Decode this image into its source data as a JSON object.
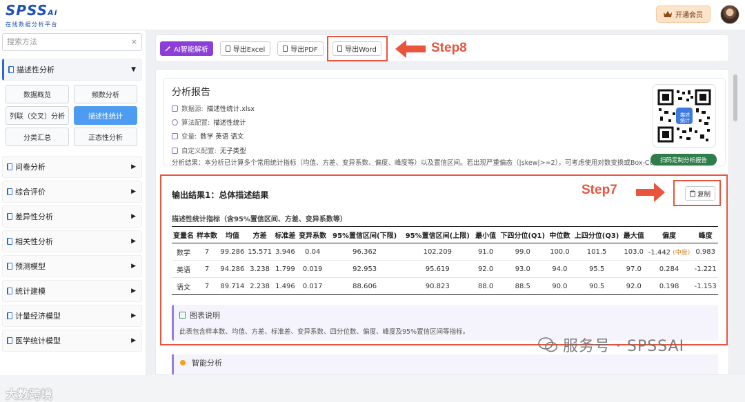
{
  "header": {
    "logo_text": "SPSS",
    "logo_ai": "Ai",
    "logo_subtitle": "在线数据分析平台",
    "vip_label": "开通会员"
  },
  "sidebar": {
    "search_placeholder": "搜索方法",
    "search_clear": "×",
    "sections": [
      {
        "label": "描述性分析",
        "open": true
      },
      {
        "label": "问卷分析"
      },
      {
        "label": "综合评价"
      },
      {
        "label": "差异性分析"
      },
      {
        "label": "相关性分析"
      },
      {
        "label": "预测模型"
      },
      {
        "label": "统计建模"
      },
      {
        "label": "计量经济模型"
      },
      {
        "label": "医学统计模型"
      }
    ],
    "sub_items": [
      "数据概览",
      "频数分析",
      "列联（交叉）分析",
      "描述性统计",
      "分类汇总",
      "正态性分析"
    ],
    "watermark": "大数跨境"
  },
  "toolbar": {
    "ai_label": "AI智能解析",
    "excel_label": "导出Excel",
    "pdf_label": "导出PDF",
    "word_label": "导出Word",
    "step8": "Step8"
  },
  "report": {
    "title": "分析报告",
    "source_label": "数据源:",
    "source_value": "描述性统计.xlsx",
    "algo_label": "算法配置:",
    "algo_value": "描述性统计",
    "vars_label": "变量:",
    "vars_value": "数学  英语  语文",
    "custom_label": "自定义配置:",
    "custom_value": "无子类型",
    "summary": "分析结果：本分析已计算多个常用统计指标（均值、方差、变异系数、偏度、峰度等）以及置信区间。若出现严重偏态（|skew|>=2），可考虑使用对数变换或Box-Cox变换",
    "qr_label": "描述统计",
    "scan_label": "扫码定制分析报告"
  },
  "output": {
    "title": "输出结果1：总体描述结果",
    "step7": "Step7",
    "copy_label": "复制",
    "table_caption": "描述性统计指标（含95%置信区间、方差、变异系数等）",
    "columns": [
      "变量名",
      "样本数",
      "均值",
      "方差",
      "标准差",
      "变异系数",
      "95%置信区间(下限)",
      "95%置信区间(上限)",
      "最小值",
      "下四分位(Q1)",
      "中位数",
      "上四分位(Q3)",
      "最大值",
      "偏度",
      "峰度"
    ],
    "rows": [
      [
        "数学",
        "7",
        "99.286",
        "15.571",
        "3.946",
        "0.04",
        "96.362",
        "102.209",
        "91.0",
        "99.0",
        "100.0",
        "101.5",
        "103.0",
        "-1.442",
        "0.983"
      ],
      [
        "英语",
        "7",
        "94.286",
        "3.238",
        "1.799",
        "0.019",
        "92.953",
        "95.619",
        "92.0",
        "93.0",
        "94.0",
        "95.5",
        "97.0",
        "0.284",
        "-1.221"
      ],
      [
        "语文",
        "7",
        "89.714",
        "2.238",
        "1.496",
        "0.017",
        "88.606",
        "90.823",
        "88.0",
        "88.5",
        "90.0",
        "90.5",
        "92.0",
        "0.198",
        "-1.153"
      ]
    ],
    "skew_tag": "(中度)",
    "note_title": "图表说明",
    "note_text": "此表包含样本数、均值、方差、标准差、变异系数、四分位数、偏度、峰度及95%置信区间等指标。",
    "smart_title": "智能分析"
  },
  "watermark_right": "服务号 · SPSSAI",
  "colors": {
    "accent": "#2a68d8",
    "highlight": "#e8543c",
    "ai_purple": "#8b3fd8",
    "active_blue": "#4e9cf2"
  }
}
